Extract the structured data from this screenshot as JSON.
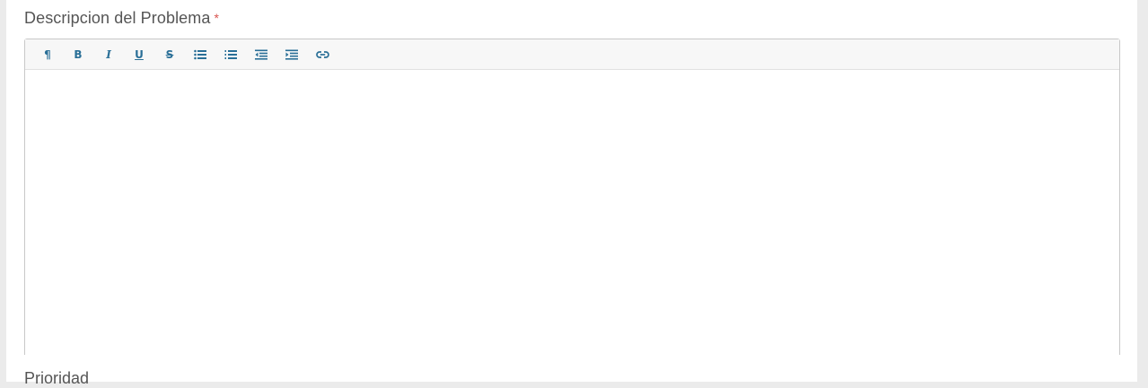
{
  "field": {
    "label": "Descripcion del Problema",
    "required_mark": "*"
  },
  "toolbar": {
    "buttons": [
      {
        "name": "paragraph",
        "glyph": "¶"
      },
      {
        "name": "bold",
        "glyph": "B"
      },
      {
        "name": "italic",
        "glyph": "I"
      },
      {
        "name": "underline",
        "glyph": "U"
      },
      {
        "name": "strikethrough",
        "glyph": "S"
      },
      {
        "name": "bullet-list",
        "glyph": ""
      },
      {
        "name": "numbered-list",
        "glyph": ""
      },
      {
        "name": "outdent",
        "glyph": ""
      },
      {
        "name": "indent",
        "glyph": ""
      },
      {
        "name": "link",
        "glyph": ""
      }
    ]
  },
  "next_field": {
    "label": "Prioridad"
  },
  "colors": {
    "icon": "#2a6f97",
    "label": "#555555",
    "required": "#d9534f"
  }
}
